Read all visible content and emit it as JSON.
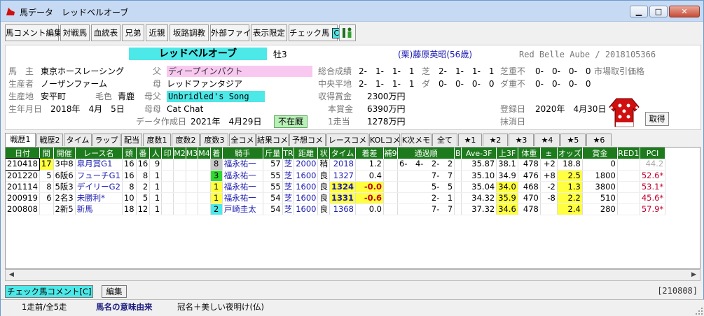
{
  "window": {
    "title": "馬データ　レッドベルオーブ",
    "min": "▁",
    "max": "□",
    "close": "✕"
  },
  "toolbar": {
    "buttons": [
      "馬コメント編集",
      "対戦馬",
      "血統表",
      "兄弟",
      "近親",
      "坂路調教",
      "外部ファイル",
      "表示限定",
      "チェック馬"
    ],
    "check_badge": "C"
  },
  "horse": {
    "name": "レッドベルオーブ",
    "sex_age": "牡3",
    "trainer": "(栗)藤原英昭(56歳)",
    "romaji_id": "Red Belle Aube / 2018105366",
    "owner_label": "馬　主",
    "owner": "東京ホースレーシング",
    "breeder_label": "生産者",
    "breeder": "ノーザンファーム",
    "birthplace_label": "生産地",
    "birthplace": "安平町",
    "coat_label": "毛色",
    "coat": "青鹿",
    "birthdate_label": "生年月日",
    "birthdate": "2018年　4月　5日",
    "sire_label": "父",
    "sire": "ディープインパクト",
    "dam_label": "母",
    "dam": "レッドファンタジア",
    "damsire_label": "母父",
    "damsire": "Unbridled's Song",
    "granddam_label": "母母",
    "granddam": "Cat Chat",
    "created_label": "データ作成日",
    "created": "2021年　4月29日",
    "absent_badge": "不在厩",
    "total_label": "総合成績",
    "total": "2-　1-　1-　1",
    "turf_label": "芝",
    "turf": "2-　1-　1-　1",
    "central_label": "中央平地",
    "central": "2-　1-　1-　1",
    "dirt_label": "ダ",
    "dirt": "0-　0-　0-　0",
    "prize_label": "収得賞金",
    "prize": "2300万円",
    "main_prize_label": "本賞金",
    "main_prize": "6390万円",
    "per_race_label": "1走当",
    "per_race": "1278万円",
    "turf_heavy_label": "芝重不",
    "turf_heavy": "0-　0-　0-　0",
    "dirt_heavy_label": "ダ重不",
    "dirt_heavy": "0-　0-　0-　0",
    "market_label": "市場取引価格",
    "reg_label": "登録日",
    "reg": "2020年　4月30日",
    "erase_label": "抹消日",
    "get_button": "取得"
  },
  "tabs": [
    "戦歴1",
    "戦歴2",
    "タイム",
    "ラップ",
    "配当",
    "度数1",
    "度数2",
    "度数3",
    "全コメ",
    "結果コメ",
    "予想コメ",
    "レースコメ",
    "KOLコメ",
    "K次メモ",
    "全て",
    "★1",
    "★2",
    "★3",
    "★4",
    "★5",
    "★6"
  ],
  "table": {
    "headers": [
      "日付",
      "間",
      "開催",
      "レース名",
      "頭",
      "番",
      "人",
      "印",
      "M2",
      "M3",
      "M4",
      "着",
      "騎手",
      "斤量",
      "TR",
      "距離",
      "状",
      "タイム",
      "着差",
      "補9",
      "通過順",
      "B",
      "Ave-3F",
      "上3F",
      "体重",
      "±",
      "オッズ",
      "賞金",
      "RED1",
      "PCI"
    ],
    "rows": [
      [
        "210418",
        "17",
        "3中8",
        "皐月賞G1",
        "16",
        "16",
        "9",
        "",
        "",
        "",
        "",
        "8",
        "福永祐一",
        "57",
        "芝",
        "2000",
        "稍",
        "2018",
        "1.2",
        "",
        "6-　4-　2-　2",
        "",
        "35.87",
        "38.1",
        "478",
        "+2",
        "18.8",
        "0",
        "",
        "44.2"
      ],
      [
        "201220",
        "5",
        "6阪6",
        "フューチG1",
        "16",
        "8",
        "1",
        "",
        "",
        "",
        "",
        "3",
        "福永祐一",
        "55",
        "芝",
        "1600",
        "良",
        "1327",
        "0.4",
        "",
        "7-　7",
        "",
        "35.10",
        "34.9",
        "476",
        "+8",
        "2.5",
        "1800",
        "",
        "52.6*"
      ],
      [
        "201114",
        "8",
        "5阪3",
        "デイリーG2",
        "8",
        "2",
        "1",
        "",
        "",
        "",
        "",
        "1",
        "福永祐一",
        "55",
        "芝",
        "1600",
        "良",
        "1324",
        "-0.0",
        "",
        "5-　5",
        "",
        "35.04",
        "34.0",
        "468",
        "-2",
        "1.3",
        "3800",
        "",
        "53.1*"
      ],
      [
        "200919",
        "6",
        "2名3",
        "未勝利*",
        "10",
        "5",
        "1",
        "",
        "",
        "",
        "",
        "1",
        "福永祐一",
        "54",
        "芝",
        "1600",
        "良",
        "1331",
        "-0.6",
        "",
        "2-　1",
        "",
        "34.32",
        "35.9",
        "470",
        "-8",
        "2.2",
        "510",
        "",
        "45.6*"
      ],
      [
        "200808",
        "",
        "2新5",
        "新馬",
        "18",
        "12",
        "1",
        "",
        "",
        "",
        "",
        "2",
        "戸崎圭太",
        "54",
        "芝",
        "1600",
        "良",
        "1368",
        "0.0",
        "",
        "7-　7",
        "",
        "37.32",
        "34.6",
        "478",
        "",
        "2.4",
        "280",
        "",
        "57.9*"
      ]
    ]
  },
  "bottom": {
    "check_comment": "チェック馬コメント[C]",
    "edit": "編集",
    "race_id": "[210808]"
  },
  "status": {
    "races": "1走前/全5走",
    "meaning_label": "馬名の意味由来",
    "meaning": "冠名＋美しい夜明け(仏)"
  },
  "colors": {
    "accent_cyan": "#4de8e8",
    "header_green": "#1d7b1d",
    "highlight_yellow": "#ffff40",
    "pink": "#f8c8f0"
  }
}
